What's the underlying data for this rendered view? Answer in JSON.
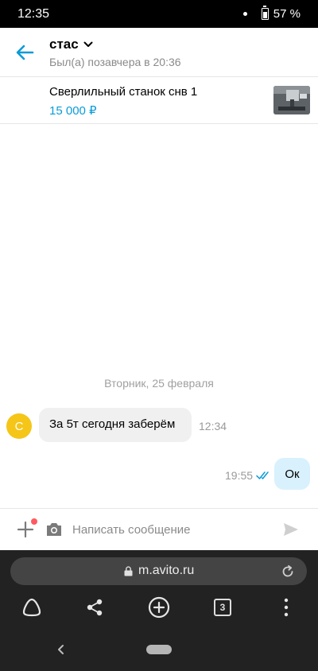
{
  "status_bar": {
    "time": "12:35",
    "battery": "57 %",
    "icons": [
      "notification-dot-icon",
      "battery-icon"
    ]
  },
  "chat_header": {
    "contact_name": "стас",
    "last_seen": "Был(а) позавчера в 20:36",
    "icons": [
      "back-arrow-icon",
      "chevron-down-icon"
    ]
  },
  "item": {
    "title": "Сверлильный станок снв 1",
    "price": "15 000 ₽"
  },
  "messages": {
    "date_separator": "Вторник, 25 февраля",
    "incoming": {
      "avatar_letter": "С",
      "text": "За 5т сегодня заберём",
      "time": "12:34"
    },
    "outgoing": {
      "text": "Ок",
      "time": "19:55",
      "status": "read"
    }
  },
  "composer": {
    "placeholder": "Написать сообщение",
    "value": "",
    "icons": [
      "plus-icon",
      "camera-icon",
      "send-icon"
    ]
  },
  "browser": {
    "url": "m.avito.ru",
    "tab_count": "3",
    "icons": [
      "lock-icon",
      "reload-icon",
      "alice-icon",
      "share-icon",
      "new-tab-icon",
      "tabs-icon",
      "more-menu-icon",
      "nav-back-icon",
      "home-pill-icon"
    ]
  },
  "colors": {
    "accent": "#0a9bd8",
    "avatar": "#f5c518",
    "outgoing_bubble": "#d8f1fd",
    "incoming_bubble": "#f0f0f0",
    "notification_dot": "#ff5a5f"
  }
}
